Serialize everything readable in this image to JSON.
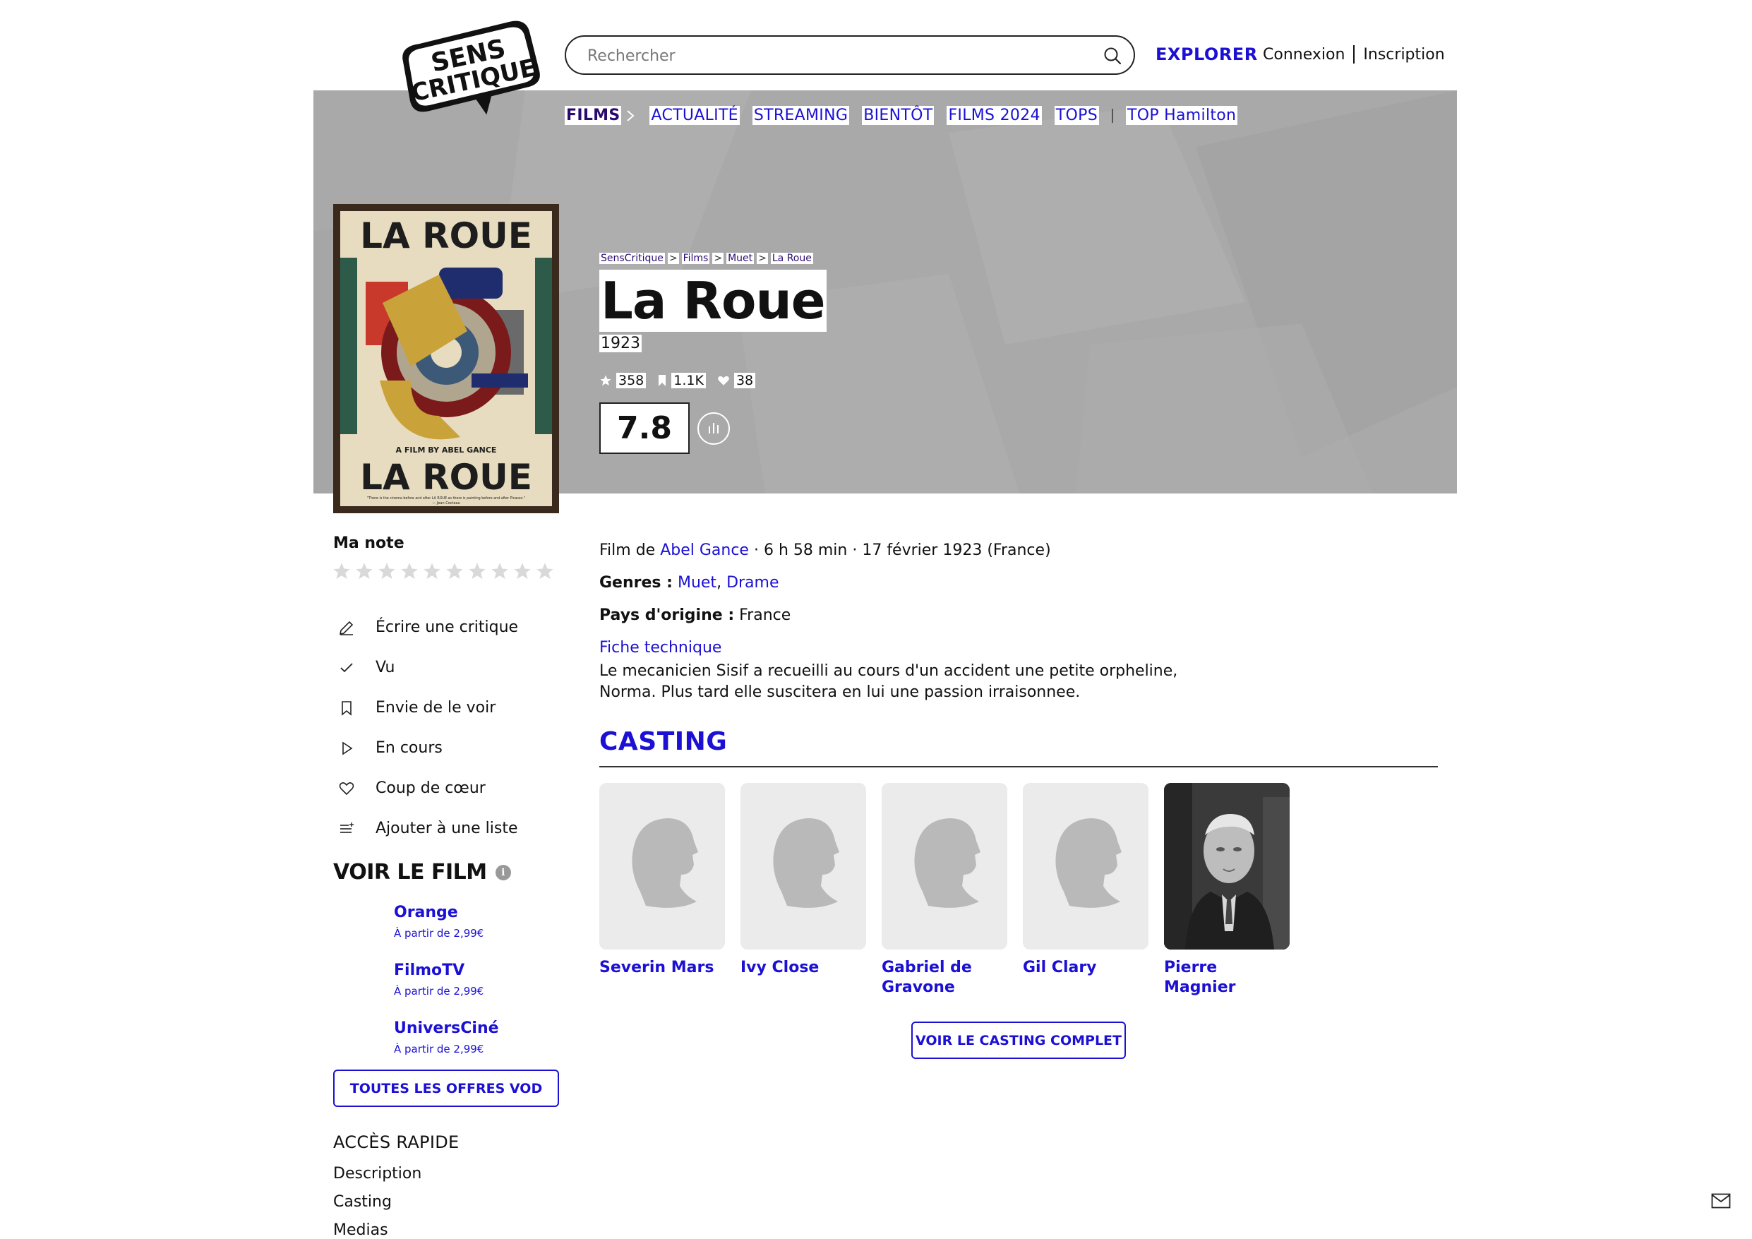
{
  "header": {
    "logo_line1": "SENS",
    "logo_line2": "CRITIQUE",
    "search_placeholder": "Rechercher",
    "explore": "EXPLORER",
    "login": "Connexion",
    "signup": "Inscription"
  },
  "subnav": {
    "items": [
      "FILMS",
      "ACTUALITÉ",
      "STREAMING",
      "BIENTÔT",
      "FILMS 2024",
      "TOPS",
      "TOP Hamilton"
    ]
  },
  "breadcrumb": [
    "SensCritique",
    "Films",
    "Muet",
    "La Roue"
  ],
  "movie": {
    "title": "La Roue",
    "year": "1923",
    "stats": {
      "ratings": "358",
      "wishlist": "1.1K",
      "favorites": "38"
    },
    "score": "7.8",
    "director_prefix": "Film de ",
    "director": "Abel Gance",
    "details_suffix": " · 6 h 58 min · 17 février 1923 (France)",
    "genres_label": "Genres :",
    "genres": [
      "Muet",
      "Drame"
    ],
    "country_label": "Pays d'origine :",
    "country": "France",
    "tech_sheet": "Fiche technique",
    "synopsis": "Le mecanicien Sisif a recueilli au cours d'un accident une petite orpheline, Norma. Plus tard elle suscitera en lui une passion irraisonnee."
  },
  "poster": {
    "title_top": "LA ROUE",
    "title_bottom": "LA ROUE",
    "credit": "A FILM BY ABEL GANCE",
    "quote": "\"There is the cinema before and after LA ROUE as there is painting before and after Picasso.\"",
    "quote_author": "— Jean Cocteau"
  },
  "sidebar": {
    "my_note": "Ma note",
    "star_count": 10,
    "actions": [
      {
        "label": "Écrire une critique",
        "icon": "pencil-icon"
      },
      {
        "label": "Vu",
        "icon": "check-icon"
      },
      {
        "label": "Envie de le voir",
        "icon": "bookmark-icon"
      },
      {
        "label": "En cours",
        "icon": "play-icon"
      },
      {
        "label": "Coup de cœur",
        "icon": "heart-icon"
      },
      {
        "label": "Ajouter à une liste",
        "icon": "add-list-icon"
      }
    ],
    "watch_title": "VOIR LE FILM",
    "offers": [
      {
        "name": "Orange",
        "price": "À partir de 2,99€"
      },
      {
        "name": "FilmoTV",
        "price": "À partir de 2,99€"
      },
      {
        "name": "UniversCiné",
        "price": "À partir de 2,99€"
      }
    ],
    "vod_button": "TOUTES LES OFFRES VOD",
    "quick_title": "ACCÈS RAPIDE",
    "quick_links": [
      "Description",
      "Casting",
      "Medias"
    ]
  },
  "casting": {
    "title": "CASTING",
    "people": [
      {
        "name": "Severin Mars",
        "has_photo": false
      },
      {
        "name": "Ivy Close",
        "has_photo": false
      },
      {
        "name": "Gabriel de Gravone",
        "has_photo": false
      },
      {
        "name": "Gil Clary",
        "has_photo": false
      },
      {
        "name": "Pierre Magnier",
        "has_photo": true
      }
    ],
    "full_button": "VOIR LE CASTING COMPLET"
  },
  "colors": {
    "accent": "#1b10d4",
    "nav_dark": "#2a0a6e",
    "hero_bg": "#a9a9a9"
  }
}
